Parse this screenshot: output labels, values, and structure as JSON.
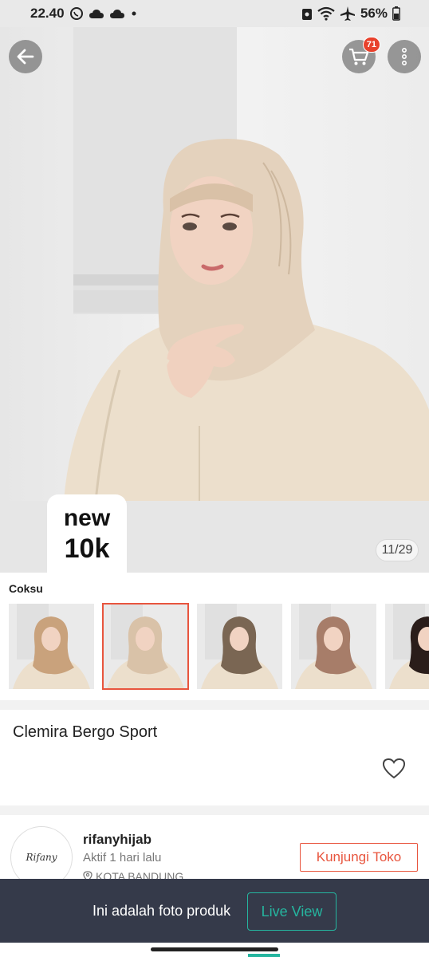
{
  "status_bar": {
    "time": "22.40",
    "battery": "56%",
    "icons_left": [
      "whatsapp-icon",
      "cloud-icon",
      "cloud-icon",
      "dot-icon"
    ],
    "icons_right": [
      "lock-icon",
      "wifi-icon",
      "airplane-icon",
      "battery-icon"
    ]
  },
  "header": {
    "cart_count": "71",
    "icons": [
      "back-arrow-icon",
      "cart-icon",
      "more-vertical-icon"
    ]
  },
  "hero": {
    "promo_line1": "new",
    "promo_line2": "10k",
    "image_counter": "11/29"
  },
  "variants": {
    "label": "Coksu",
    "selected_index": 1,
    "items": [
      {
        "color": "#c9a27c"
      },
      {
        "color": "#d9c2a8"
      },
      {
        "color": "#7a6653"
      },
      {
        "color": "#a77d69"
      },
      {
        "color": "#2a1d1a"
      }
    ]
  },
  "product": {
    "title": "Clemira Bergo Sport",
    "icons": [
      "heart-icon"
    ]
  },
  "shop": {
    "avatar_text": "Rifany",
    "name": "rifanyhijab",
    "status": "Aktif 1 hari lalu",
    "location": "KOTA BANDUNG",
    "visit_label": "Kunjungi Toko"
  },
  "toast": {
    "message": "Ini adalah foto produk",
    "live_label": "Live View"
  },
  "colors": {
    "accent": "#e8553e",
    "toast_bg": "#353a4a",
    "live_accent": "#25b59f",
    "badge": "#e8412c"
  }
}
